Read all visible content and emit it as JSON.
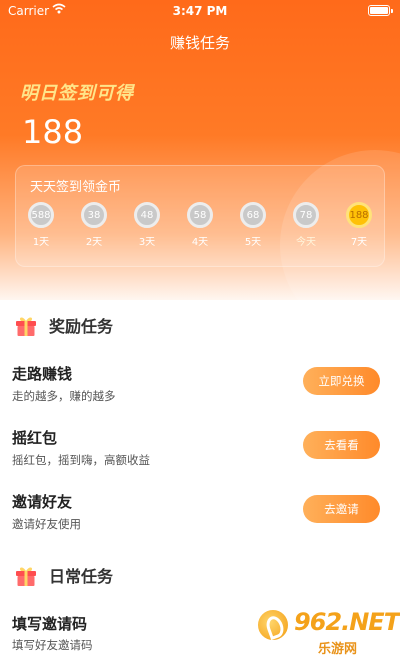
{
  "status_bar": {
    "carrier": "Carrier",
    "time": "3:47 PM"
  },
  "nav": {
    "title": "赚钱任务"
  },
  "tomorrow": {
    "label": "明日签到可得",
    "amount": "188"
  },
  "signin": {
    "title": "天天签到领金币",
    "days": [
      {
        "coins": "588",
        "label": "1天",
        "active": false
      },
      {
        "coins": "38",
        "label": "2天",
        "active": false
      },
      {
        "coins": "48",
        "label": "3天",
        "active": false
      },
      {
        "coins": "58",
        "label": "4天",
        "active": false
      },
      {
        "coins": "68",
        "label": "5天",
        "active": false
      },
      {
        "coins": "78",
        "label": "今天",
        "active": false
      },
      {
        "coins": "188",
        "label": "7天",
        "active": true
      }
    ]
  },
  "reward_section": {
    "title": "奖励任务",
    "tasks": [
      {
        "title": "走路赚钱",
        "desc": "走的越多，赚的越多",
        "button": "立即兑换"
      },
      {
        "title": "摇红包",
        "desc": "摇红包，摇到嗨，高额收益",
        "button": "去看看"
      },
      {
        "title": "邀请好友",
        "desc": "邀请好友使用",
        "button": "去邀请"
      }
    ]
  },
  "daily_section": {
    "title": "日常任务",
    "tasks": [
      {
        "title": "填写邀请码",
        "desc": "填写好友邀请码"
      }
    ]
  },
  "watermark": {
    "site": "962.NET",
    "name": "乐游网"
  },
  "colors": {
    "accent": "#ff6a1a",
    "button": "#ff8a2a",
    "gold": "#ffc107"
  }
}
